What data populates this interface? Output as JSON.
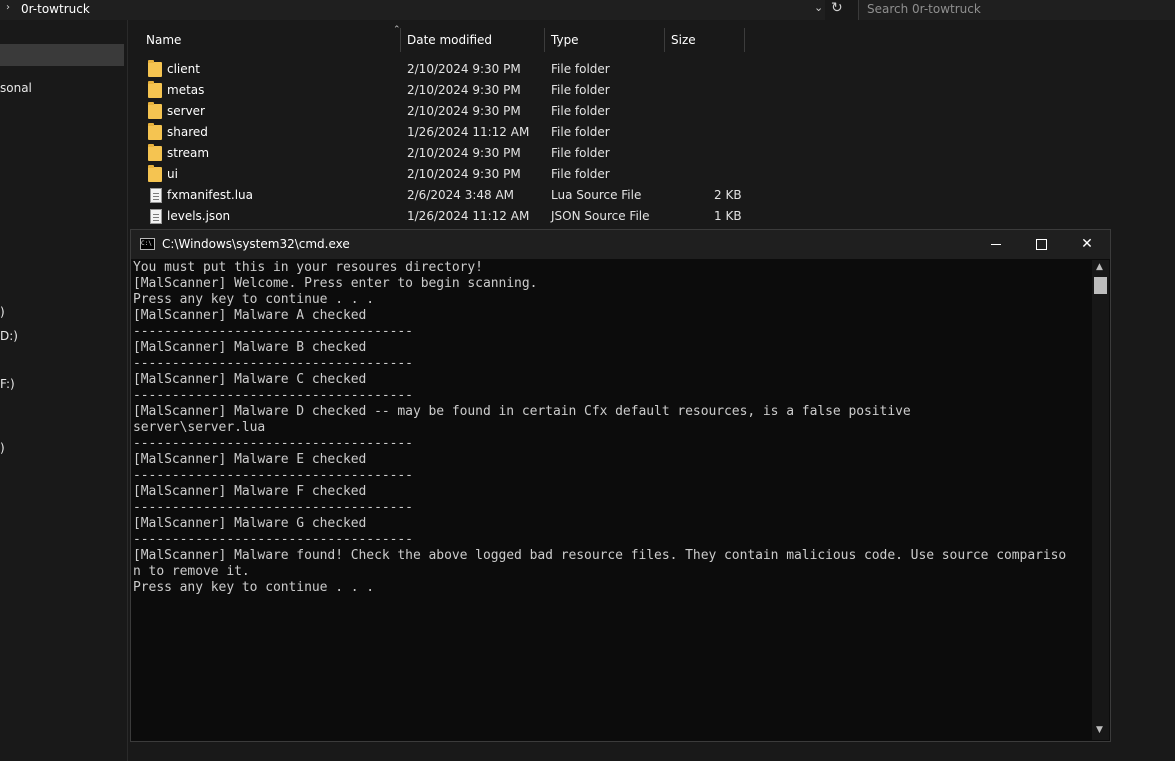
{
  "explorer": {
    "address_path": "0r-towtruck",
    "search_placeholder": "Search 0r-towtruck",
    "nav_fragments": [
      "sonal",
      ")",
      "D:)",
      "F:)",
      ")"
    ],
    "columns": {
      "name": "Name",
      "date": "Date modified",
      "type": "Type",
      "size": "Size"
    },
    "files": [
      {
        "name": "client",
        "date": "2/10/2024 9:30 PM",
        "type": "File folder",
        "size": "",
        "icon": "folder-icon"
      },
      {
        "name": "metas",
        "date": "2/10/2024 9:30 PM",
        "type": "File folder",
        "size": "",
        "icon": "folder-icon"
      },
      {
        "name": "server",
        "date": "2/10/2024 9:30 PM",
        "type": "File folder",
        "size": "",
        "icon": "folder-icon"
      },
      {
        "name": "shared",
        "date": "1/26/2024 11:12 AM",
        "type": "File folder",
        "size": "",
        "icon": "folder-icon"
      },
      {
        "name": "stream",
        "date": "2/10/2024 9:30 PM",
        "type": "File folder",
        "size": "",
        "icon": "folder-icon"
      },
      {
        "name": "ui",
        "date": "2/10/2024 9:30 PM",
        "type": "File folder",
        "size": "",
        "icon": "folder-icon"
      },
      {
        "name": "fxmanifest.lua",
        "date": "2/6/2024 3:48 AM",
        "type": "Lua Source File",
        "size": "2 KB",
        "icon": "document-icon"
      },
      {
        "name": "levels.json",
        "date": "1/26/2024 11:12 AM",
        "type": "JSON Source File",
        "size": "1 KB",
        "icon": "document-icon"
      }
    ]
  },
  "cmd": {
    "title": "C:\\Windows\\system32\\cmd.exe",
    "icon_text": "C:\\",
    "close_glyph": "✕",
    "console_lines": [
      "You must put this in your resoures directory!",
      "[MalScanner] Welcome. Press enter to begin scanning.",
      "Press any key to continue . . .",
      "[MalScanner] Malware A checked",
      "------------------------------------",
      "[MalScanner] Malware B checked",
      "------------------------------------",
      "[MalScanner] Malware C checked",
      "------------------------------------",
      "[MalScanner] Malware D checked -- may be found in certain Cfx default resources, is a false positive",
      "server\\server.lua",
      "------------------------------------",
      "[MalScanner] Malware E checked",
      "------------------------------------",
      "[MalScanner] Malware F checked",
      "------------------------------------",
      "[MalScanner] Malware G checked",
      "------------------------------------",
      "[MalScanner] Malware found! Check the above logged bad resource files. They contain malicious code. Use source compariso",
      "n to remove it.",
      "Press any key to continue . . ."
    ]
  },
  "colors": {
    "background": "#191919",
    "console_bg": "#0c0c0c",
    "console_text": "#cccccc",
    "folder": "#f5c451"
  }
}
